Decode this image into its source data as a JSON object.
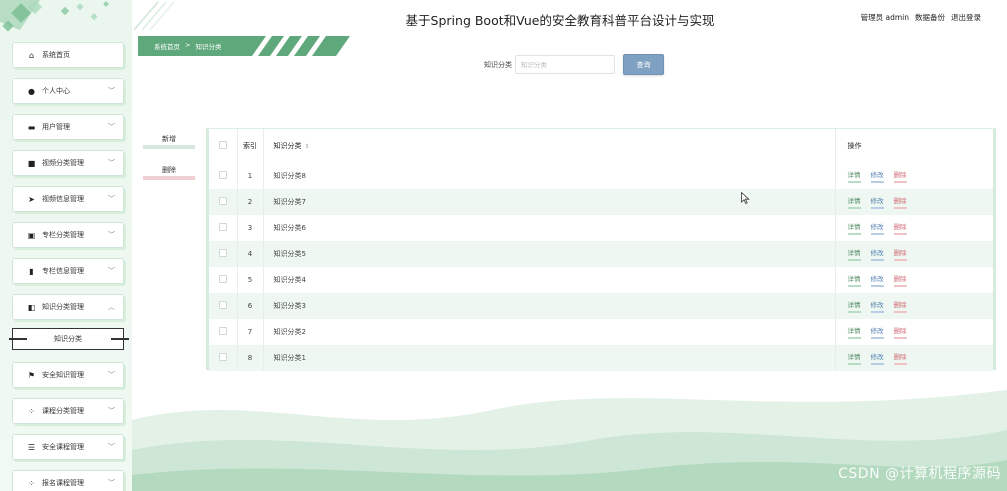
{
  "app": {
    "title": "基于Spring Boot和Vue的安全教育科普平台设计与实现"
  },
  "header": {
    "user_label": "管理员 admin",
    "backup_label": "数据备份",
    "logout_label": "退出登录"
  },
  "breadcrumb": {
    "home": "系统首页",
    "separator": ">",
    "current": "知识分类"
  },
  "sidebar": {
    "items": [
      {
        "label": "系统首页",
        "icon": "home-icon",
        "chevron": false
      },
      {
        "label": "个人中心",
        "icon": "user-icon",
        "chevron": true
      },
      {
        "label": "用户管理",
        "icon": "chat-icon",
        "chevron": true
      },
      {
        "label": "视频分类管理",
        "icon": "server-icon",
        "chevron": true
      },
      {
        "label": "视频信息管理",
        "icon": "send-icon",
        "chevron": true
      },
      {
        "label": "专栏分类管理",
        "icon": "clipboard-icon",
        "chevron": true
      },
      {
        "label": "专栏信息管理",
        "icon": "chart-icon",
        "chevron": true
      },
      {
        "label": "知识分类管理",
        "icon": "thumb-icon",
        "chevron": true,
        "expanded": true
      },
      {
        "label": "安全知识管理",
        "icon": "flag-icon",
        "chevron": true
      },
      {
        "label": "课程分类管理",
        "icon": "grid-icon",
        "chevron": true
      },
      {
        "label": "安全课程管理",
        "icon": "sliders-icon",
        "chevron": true
      },
      {
        "label": "报名课程管理",
        "icon": "grid-icon",
        "chevron": true
      }
    ],
    "sub_item": "知识分类"
  },
  "search": {
    "label": "知识分类",
    "placeholder": "知识分类",
    "button": "查询"
  },
  "actions": {
    "add": "新增",
    "delete": "删除"
  },
  "table": {
    "headers": {
      "index": "索引",
      "name": "知识分类",
      "ops": "操作"
    },
    "rows": [
      {
        "index": "1",
        "name": "知识分类8"
      },
      {
        "index": "2",
        "name": "知识分类7"
      },
      {
        "index": "3",
        "name": "知识分类6"
      },
      {
        "index": "4",
        "name": "知识分类5"
      },
      {
        "index": "5",
        "name": "知识分类4"
      },
      {
        "index": "6",
        "name": "知识分类3"
      },
      {
        "index": "7",
        "name": "知识分类2"
      },
      {
        "index": "8",
        "name": "知识分类1"
      }
    ],
    "op_labels": {
      "detail": "详情",
      "edit": "修改",
      "delete": "删除"
    }
  },
  "watermark": "CSDN @计算机程序源码",
  "colors": {
    "accent_green": "#5fa87c",
    "search_button": "#7ea1c2",
    "row_stripe": "#eef7f1",
    "delete_red": "#d06a73"
  }
}
